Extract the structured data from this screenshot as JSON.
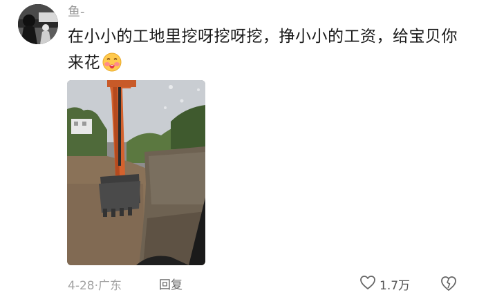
{
  "comment": {
    "username": "鱼-",
    "text": "在小小的工地里挖呀挖呀挖，挣小小的工资，给宝贝你来花",
    "emoji": "blush-face-emoji",
    "date": "4-28",
    "location": "广东",
    "reply_label": "回复",
    "like_count": "1.7万"
  },
  "icons": {
    "like": "heart-outline-icon",
    "dislike": "broken-heart-outline-icon"
  },
  "colors": {
    "text_primary": "#1a1a1a",
    "text_secondary": "#a2a2a2",
    "excavator_orange": "#d4622e"
  }
}
